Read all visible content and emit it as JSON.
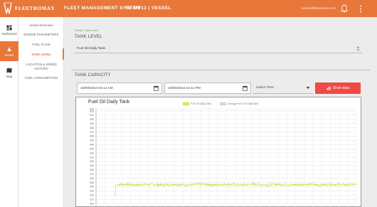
{
  "topbar": {
    "logo_text": "FLEETROMAX",
    "app_title": "FLEET MANAGEMENT SYSTEM",
    "vessel": "TB MV13 | VESSEL",
    "user_email": "vessel@fleetromax.com",
    "accent": "#e8773a"
  },
  "rail": {
    "items": [
      {
        "label": "Dashboard",
        "icon": "dashboard-icon"
      },
      {
        "label": "Vessel",
        "icon": "vessel-icon"
      },
      {
        "label": "Map",
        "icon": "map-icon"
      }
    ]
  },
  "subnav": {
    "items": [
      {
        "label": "Vessel Overview"
      },
      {
        "label": "ENGINE PARAMETERS"
      },
      {
        "label": "FUEL FLOW"
      },
      {
        "label": "TANK LEVEL"
      },
      {
        "label": "LOCATION & SPEED HISTORY"
      },
      {
        "label": "FUEL CONSUMPTION"
      }
    ]
  },
  "main": {
    "breadcrumb_home": "Vessel / ",
    "breadcrumb_current": "Tank Level",
    "tank_level_title": "TANK LEVEL",
    "tank_select_value": "Fuel Oil Daily Tank",
    "tank_capacity_title": "TANK CAPACITY",
    "start_date": "19/09/2024 04:14 AM",
    "end_date": "19/09/2024 10:14 PM",
    "select_label": "Select Time",
    "show_button": "Show data"
  },
  "chart_data": {
    "type": "line",
    "title": "Fuel Oil Daily Tank",
    "legend": "top-center",
    "grid": true,
    "ylim": [
      290,
      525
    ],
    "yticks": [
      525,
      520,
      510,
      500,
      490,
      480,
      470,
      460,
      450,
      440,
      430,
      420,
      410,
      400,
      390,
      380,
      370,
      360,
      350,
      340,
      330,
      320,
      310,
      300,
      290
    ],
    "series": [
      {
        "name": "Fuel Oil Daily Tank",
        "color": "#d4d42a",
        "start": 0.08,
        "end": 1.0,
        "value": 345,
        "noise": 3
      },
      {
        "name": "Average Fuel Oil Daily Tank",
        "color": "#b9c7d6",
        "values": []
      }
    ]
  }
}
